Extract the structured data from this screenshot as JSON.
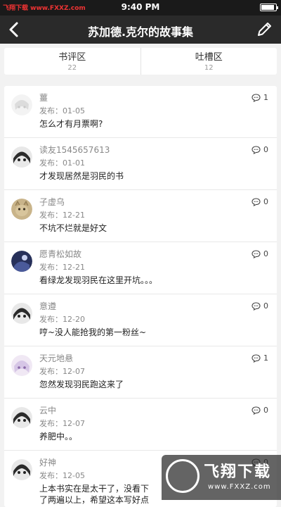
{
  "status_bar": {
    "watermark": "飞翔下载 www.FXXZ.com",
    "time": "9:40 PM",
    "battery_level": 0.9
  },
  "nav": {
    "title": "苏加德.克尔的故事集"
  },
  "tabs": [
    {
      "label": "书评区",
      "count": "22"
    },
    {
      "label": "吐槽区",
      "count": "12"
    }
  ],
  "comments": [
    {
      "user": "薑",
      "date": "发布：01-05",
      "text": "怎么才有月票啊?",
      "replies": "1",
      "avatar": "faded-anime-avatar"
    },
    {
      "user": "读友1545657613",
      "date": "发布：01-01",
      "text": "才发现居然是羽民的书",
      "replies": "0",
      "avatar": "anime-girl-avatar"
    },
    {
      "user": "子虚乌",
      "date": "发布：12-21",
      "text": "不坑不烂就是好文",
      "replies": "0",
      "avatar": "cat-avatar"
    },
    {
      "user": "愿青松如故",
      "date": "发布：12-21",
      "text": "看绿龙发现羽民在这里开坑。。。",
      "replies": "0",
      "avatar": "dark-scene-avatar"
    },
    {
      "user": "意遵",
      "date": "发布：12-20",
      "text": "哼~没人能抢我的第一粉丝~",
      "replies": "0",
      "avatar": "anime-girl-avatar"
    },
    {
      "user": "天元地悬",
      "date": "发布：12-07",
      "text": "忽然发现羽民跑这来了",
      "replies": "1",
      "avatar": "anime-character-avatar"
    },
    {
      "user": "云中",
      "date": "发布：12-07",
      "text": "养肥中。。",
      "replies": "0",
      "avatar": "anime-girl-avatar"
    },
    {
      "user": "好神",
      "date": "发布：12-05",
      "text": "上本书实在是太干了，没看下",
      "text2": "了两遍以上，希望这本写好点",
      "replies": "0",
      "avatar": "anime-girl-avatar"
    }
  ],
  "watermark": {
    "big": "飞翔下载",
    "small": "www.FXXZ.com"
  }
}
